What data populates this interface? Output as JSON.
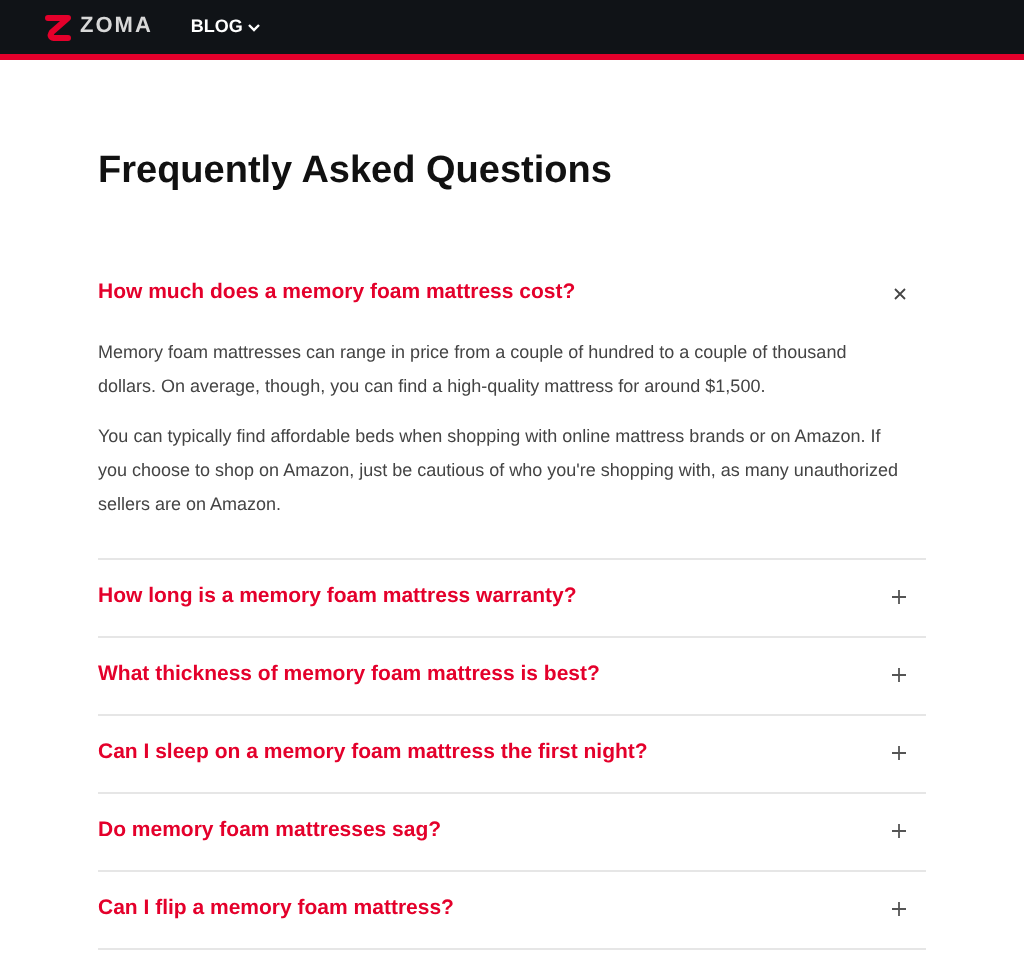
{
  "header": {
    "brand": "ZOMA",
    "nav": [
      {
        "label": "BLOG",
        "has_menu": true
      }
    ]
  },
  "title": "Frequently Asked Questions",
  "faq": [
    {
      "question": "How much does a memory foam mattress cost?",
      "expanded": true,
      "answer": [
        "Memory foam mattresses can range in price from a couple of hundred to a couple of thousand dollars. On average, though, you can find a high-quality mattress for around $1,500.",
        "You can typically find affordable beds when shopping with online mattress brands or on Amazon. If you choose to shop on Amazon, just be cautious of who you're shopping with, as many unauthorized sellers are on Amazon."
      ]
    },
    {
      "question": "How long is a memory foam mattress warranty?",
      "expanded": false
    },
    {
      "question": "What thickness of memory foam mattress is best?",
      "expanded": false
    },
    {
      "question": "Can I sleep on a memory foam mattress the first night?",
      "expanded": false
    },
    {
      "question": "Do memory foam mattresses sag?",
      "expanded": false
    },
    {
      "question": "Can I flip a memory foam mattress?",
      "expanded": false
    }
  ]
}
